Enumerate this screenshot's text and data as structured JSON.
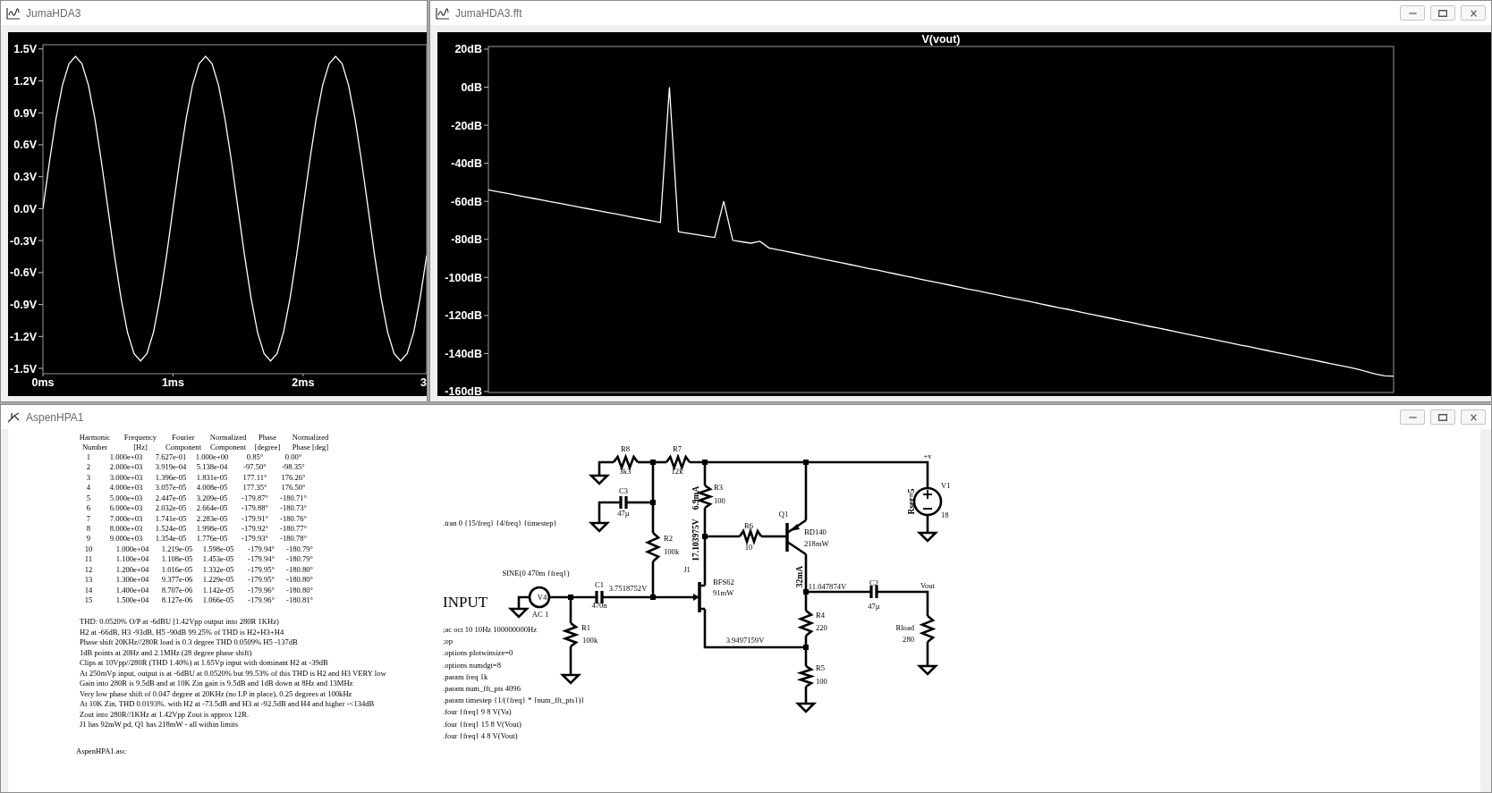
{
  "windows": [
    {
      "title": "JumaHDA3",
      "kind": "plot",
      "window_buttons": false,
      "axis_edge_text": "3",
      "chart_data": {
        "type": "line",
        "x": [
          0,
          0.05,
          0.1,
          0.15,
          0.2,
          0.25,
          0.3,
          0.35,
          0.4,
          0.45,
          0.5,
          0.55,
          0.6,
          0.65,
          0.7,
          0.75,
          0.8,
          0.85,
          0.9,
          0.95,
          1,
          1.05,
          1.1,
          1.15,
          1.2,
          1.25,
          1.3,
          1.35,
          1.4,
          1.45,
          1.5,
          1.55,
          1.6,
          1.65,
          1.7,
          1.75,
          1.8,
          1.85,
          1.9,
          1.95,
          2,
          2.05,
          2.1,
          2.15,
          2.2,
          2.25,
          2.3,
          2.35,
          2.4,
          2.45,
          2.5,
          2.55,
          2.6,
          2.65,
          2.7,
          2.75,
          2.8,
          2.85,
          2.9,
          2.95
        ],
        "series": [
          {
            "color": "#ffffff",
            "values": [
              0,
              0.44,
              0.84,
              1.16,
              1.36,
              1.43,
              1.36,
              1.16,
              0.84,
              0.44,
              0,
              -0.44,
              -0.84,
              -1.16,
              -1.36,
              -1.43,
              -1.36,
              -1.16,
              -0.84,
              -0.44,
              0,
              0.44,
              0.84,
              1.16,
              1.36,
              1.43,
              1.36,
              1.16,
              0.84,
              0.44,
              0,
              -0.44,
              -0.84,
              -1.16,
              -1.36,
              -1.43,
              -1.36,
              -1.16,
              -0.84,
              -0.44,
              0,
              0.44,
              0.84,
              1.16,
              1.36,
              1.43,
              1.36,
              1.16,
              0.84,
              0.44,
              0,
              -0.44,
              -0.84,
              -1.16,
              -1.36,
              -1.43,
              -1.36,
              -1.16,
              -0.84,
              -0.44
            ]
          }
        ],
        "xlim": [
          0,
          2.95
        ],
        "ylim": [
          -1.55,
          1.54
        ],
        "xticks": [
          {
            "value": 0,
            "label": "0ms"
          },
          {
            "value": 1,
            "label": "1ms"
          },
          {
            "value": 2,
            "label": "2ms"
          }
        ],
        "yticks": [
          {
            "value": 1.5,
            "label": "1.5V"
          },
          {
            "value": 1.2,
            "label": "1.2V"
          },
          {
            "value": 0.9,
            "label": "0.9V"
          },
          {
            "value": 0.6,
            "label": "0.6V"
          },
          {
            "value": 0.3,
            "label": "0.3V"
          },
          {
            "value": 0,
            "label": "0.0V"
          },
          {
            "value": -0.3,
            "label": "-0.3V"
          },
          {
            "value": -0.6,
            "label": "-0.6V"
          },
          {
            "value": -0.9,
            "label": "-0.9V"
          },
          {
            "value": -1.2,
            "label": "-1.2V"
          },
          {
            "value": -1.5,
            "label": "-1.5V"
          }
        ]
      }
    },
    {
      "title": "JumaHDA3.fft",
      "kind": "plot",
      "window_buttons": true,
      "chart_data": {
        "type": "line",
        "title": "V(vout)",
        "categories": [
          null,
          null,
          null,
          null,
          null,
          null,
          null,
          null,
          null,
          null,
          null,
          null,
          null,
          null,
          null,
          null,
          null,
          null,
          null,
          null,
          null,
          null,
          null,
          null,
          null,
          null,
          null,
          null,
          null,
          null,
          null,
          null,
          null,
          null,
          null,
          null,
          null,
          null,
          null,
          null,
          null,
          null,
          null,
          null,
          null,
          null,
          null,
          null,
          null,
          null,
          null,
          null,
          null,
          null,
          null,
          null,
          null,
          null,
          null,
          null,
          null,
          null,
          null,
          null,
          null,
          null,
          null,
          null,
          null,
          null,
          null,
          null,
          null,
          null,
          null,
          null,
          null,
          null,
          null,
          null,
          null,
          null,
          null,
          null,
          null,
          null,
          null,
          null,
          null,
          null,
          null,
          null,
          null,
          null,
          null,
          null,
          null,
          null,
          null,
          null,
          null
        ],
        "series": [
          {
            "color": "#ffffff",
            "values": [
              -54,
              -54.9,
              -55.8,
              -56.7,
              -57.6,
              -58.5,
              -59.4,
              -60.3,
              -61.2,
              -62.1,
              -63,
              -63.9,
              -64.8,
              -65.7,
              -66.6,
              -67.5,
              -68.4,
              -69.3,
              -70.2,
              -71.1,
              0,
              -76,
              -76.8,
              -77.5,
              -78.3,
              -79,
              -60,
              -80.5,
              -81.3,
              -82,
              -81,
              -84.5,
              -85.5,
              -86.4,
              -87.4,
              -88.4,
              -89.4,
              -90.4,
              -91.3,
              -92.3,
              -93.3,
              -94.3,
              -95.3,
              -96.2,
              -97.2,
              -98.2,
              -99.2,
              -100.2,
              -101.2,
              -102.1,
              -103.1,
              -104.1,
              -105.1,
              -106.1,
              -107,
              -108,
              -109,
              -110,
              -111,
              -111.9,
              -112.9,
              -113.9,
              -114.9,
              -115.9,
              -116.8,
              -117.8,
              -118.8,
              -119.8,
              -120.8,
              -121.7,
              -122.7,
              -123.7,
              -124.7,
              -125.7,
              -126.6,
              -127.6,
              -128.6,
              -129.6,
              -130.6,
              -131.5,
              -132.5,
              -133.5,
              -134.5,
              -135.5,
              -136.4,
              -137.4,
              -138.4,
              -139.4,
              -140.4,
              -141.3,
              -142.3,
              -143.3,
              -144.3,
              -145.3,
              -146.2,
              -147.2,
              -148.2,
              -149.5,
              -150.8,
              -151.7,
              -152
            ]
          }
        ],
        "ylim": [
          -160.5,
          21.4
        ],
        "yticks": [
          {
            "value": 20,
            "label": "20dB"
          },
          {
            "value": 0,
            "label": "0dB"
          },
          {
            "value": -20,
            "label": "-20dB"
          },
          {
            "value": -40,
            "label": "-40dB"
          },
          {
            "value": -60,
            "label": "-60dB"
          },
          {
            "value": -80,
            "label": "-80dB"
          },
          {
            "value": -100,
            "label": "-100dB"
          },
          {
            "value": -120,
            "label": "-120dB"
          },
          {
            "value": -140,
            "label": "-140dB"
          },
          {
            "value": -160,
            "label": "-160dB"
          }
        ]
      }
    },
    {
      "title": "AspenHPA1",
      "kind": "schematic",
      "window_buttons": true,
      "fourier_table": {
        "header_rows": [
          [
            "Harmonic",
            "Frequency",
            "Fourier",
            "Normalized",
            "Phase",
            "Normalized"
          ],
          [
            "Number",
            "[Hz]",
            "Component",
            "Component",
            "[degree]",
            "Phase [deg]"
          ]
        ],
        "rows": [
          [
            "1",
            "1.000e+03",
            "7.627e-01",
            "1.000e+00",
            "0.85°",
            "0.00°"
          ],
          [
            "2",
            "2.000e+03",
            "3.919e-04",
            "5.138e-04",
            "-97.50°",
            "-98.35°"
          ],
          [
            "3",
            "3.000e+03",
            "1.396e-05",
            "1.831e-05",
            "177.11°",
            "176.26°"
          ],
          [
            "4",
            "4.000e+03",
            "3.057e-05",
            "4.008e-05",
            "177.35°",
            "176.50°"
          ],
          [
            "5",
            "5.000e+03",
            "2.447e-05",
            "3.209e-05",
            "-179.87°",
            "-180.71°"
          ],
          [
            "6",
            "6.000e+03",
            "2.032e-05",
            "2.664e-05",
            "-179.88°",
            "-180.73°"
          ],
          [
            "7",
            "7.000e+03",
            "1.741e-05",
            "2.283e-05",
            "-179.91°",
            "-180.76°"
          ],
          [
            "8",
            "8.000e+03",
            "1.524e-05",
            "1.998e-05",
            "-179.92°",
            "-180.77°"
          ],
          [
            "9",
            "9.000e+03",
            "1.354e-05",
            "1.776e-05",
            "-179.93°",
            "-180.78°"
          ],
          [
            "10",
            "1.000e+04",
            "1.219e-05",
            "1.598e-05",
            "-179.94°",
            "-180.79°"
          ],
          [
            "11",
            "1.100e+04",
            "1.108e-05",
            "1.453e-05",
            "-179.94°",
            "-180.79°"
          ],
          [
            "12",
            "1.200e+04",
            "1.016e-05",
            "1.332e-05",
            "-179.95°",
            "-180.80°"
          ],
          [
            "13",
            "1.300e+04",
            "9.377e-06",
            "1.229e-05",
            "-179.95°",
            "-180.80°"
          ],
          [
            "14",
            "1.400e+04",
            "8.707e-06",
            "1.142e-05",
            "-179.96°",
            "-180.80°"
          ],
          [
            "15",
            "1.500e+04",
            "8.127e-06",
            "1.066e-05",
            "-179.96°",
            "-180.81°"
          ]
        ]
      },
      "notes": [
        "THD: 0.0520%  O/P at -6dBU [1.42Vpp output into 280R 1KHz)",
        "H2 at -66dB, H3 -93dB,  H5 -90dB 99.25% of THD is H2+H3+H4",
        "Phase shift 20KHz//280R load is 0.3 degree THD 0.0509% H5 -137dB",
        "1dB points at 20Hz and 2.1MHz (28 degree phase shift)",
        "Clips at 10Vpp//280R (THD 1.40%) at 1.65Vp input with dominant H2 at -39dB",
        "At 250mVp input, output is at -6dBU at 0.0520% but 99.53% of this THD is H2 and H3 VERY low",
        "Gain into 280R is 9.5dB and at 10K Zin gain is 9.5dB and 1dB down at 8Hz and 13MHz",
        "Very low phase shift of 0.047 degree at 20KHz (no LP in place), 0.25 degrees at 100kHz",
        "At 10K Zin, THD 0.0193%. with H2 at -73.5dB and H3 at -92.5dB and H4 and higher -<134dB",
        "Zout into 280R//1KHz at 1.42Vpp Zout is approx 12R.",
        "J1 has 92mW pd, Q1 has 218mW - all within limits"
      ],
      "file_label": "AspenHPA1.asc",
      "schematic": {
        "heading": "INPUT",
        "components": [
          {
            "ref": "R8",
            "value": "3k3"
          },
          {
            "ref": "R7",
            "value": "12k"
          },
          {
            "ref": "R3",
            "value": "100"
          },
          {
            "ref": "C3",
            "value": "47µ"
          },
          {
            "ref": "R2",
            "value": "100k"
          },
          {
            "ref": "V4",
            "value": "SINE(0 470m {freq})",
            "extra": "AC 1"
          },
          {
            "ref": "C1",
            "value": "470n"
          },
          {
            "ref": "R1",
            "value": "100k"
          },
          {
            "ref": "J1",
            "value": "BFS62",
            "extra": "91mW"
          },
          {
            "ref": "R6",
            "value": "10"
          },
          {
            "ref": "Q1",
            "value": "BD140",
            "extra": "218mW"
          },
          {
            "ref": "R4",
            "value": "220"
          },
          {
            "ref": "R5",
            "value": "100"
          },
          {
            "ref": "C2",
            "value": "47µ"
          },
          {
            "ref": "Rload",
            "value": "280"
          },
          {
            "ref": "V1",
            "value": "18",
            "extra": "Rser=5"
          }
        ],
        "net_labels": [
          "+v",
          "Vout"
        ],
        "probes": [
          "3.7518752V",
          "17.103975V",
          "6.9mA",
          "11.047874V",
          "32mA",
          "3.9497159V"
        ],
        "directives": [
          ".tran 0 {15/freq} {4/freq} {timestep}",
          ";ac oct 10 10Hz 100000000Hz",
          ";op",
          ".options plotwinsize=0",
          ".options numdgt=8",
          ".param freq 1k",
          ".param num_fft_pts 4096",
          ".param timestep {1/({freq} * {num_fft_pts})}",
          ".four {freq} 9 8 V(Va)",
          ".four {freq} 15 8 V(Vout)",
          ".four {freq} 4 8 V(Vout)"
        ]
      }
    }
  ]
}
